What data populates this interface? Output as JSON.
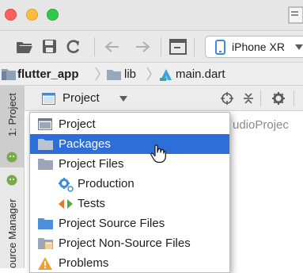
{
  "toolbar": {
    "device_name": "iPhone XR",
    "icons": [
      "open-folder-icon",
      "save-icon",
      "sync-icon",
      "back-arrow-icon",
      "forward-arrow-icon",
      "terminal-icon",
      "phone-icon",
      "chevron-down-icon"
    ]
  },
  "breadcrumb": {
    "items": [
      "flutter_app",
      "lib",
      "main.dart"
    ]
  },
  "side_strip": {
    "project_tab": "1: Project",
    "manager_tab": "ource Manager"
  },
  "panel": {
    "view_selector": "Project",
    "path_fragment": "udioProjec"
  },
  "dropdown": {
    "selected_index": 1,
    "items": [
      {
        "label": "Project",
        "icon": "project-window-icon"
      },
      {
        "label": "Packages",
        "icon": "folder-icon"
      },
      {
        "label": "Project Files",
        "icon": "folder-icon"
      },
      {
        "label": "Production",
        "icon": "production-gear-icon"
      },
      {
        "label": "Tests",
        "icon": "tests-arrows-icon"
      },
      {
        "label": "Project Source Files",
        "icon": "folder-icon"
      },
      {
        "label": "Project Non-Source Files",
        "icon": "non-source-files-icon"
      },
      {
        "label": "Problems",
        "icon": "warning-icon"
      }
    ]
  },
  "colors": {
    "selection": "#2d6ed8",
    "folder": "#9aa7b8",
    "accent_blue": "#3d8be0",
    "close_light": "#fc605b",
    "minimize_light": "#fdbc40",
    "maximize_light": "#34c84a"
  }
}
